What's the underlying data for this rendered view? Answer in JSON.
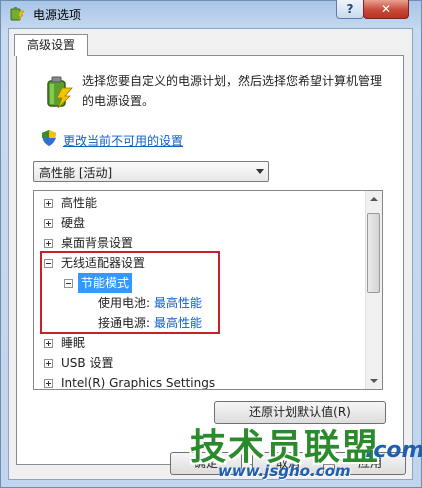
{
  "window": {
    "title": "电源选项",
    "help_label": "?",
    "close_label": "✕"
  },
  "tab": {
    "label": "高级设置"
  },
  "description": {
    "line1": "选择您要自定义的电源计划，然后选择您希望计算机管理",
    "line2": "的电源设置。"
  },
  "change_link": "更改当前不可用的设置",
  "plan_select": {
    "value": "高性能 [活动]"
  },
  "tree": {
    "items": [
      {
        "label": "高性能",
        "expander": "plus"
      },
      {
        "label": "硬盘",
        "expander": "plus"
      },
      {
        "label": "桌面背景设置",
        "expander": "plus"
      },
      {
        "label": "无线适配器设置",
        "expander": "minus"
      },
      {
        "label": "节能模式",
        "expander": "minus",
        "selected": true
      },
      {
        "label": "使用电池:",
        "value": "最高性能"
      },
      {
        "label": "接通电源:",
        "value": "最高性能"
      },
      {
        "label": "睡眠",
        "expander": "plus"
      },
      {
        "label": "USB 设置",
        "expander": "plus"
      },
      {
        "label": "Intel(R) Graphics Settings",
        "expander": "plus"
      }
    ]
  },
  "buttons": {
    "restore": "还原计划默认值(R)",
    "ok": "确定",
    "cancel": "取消",
    "apply": "应用"
  },
  "watermark": {
    "main": "技术员联盟",
    "url": "www.jsgho.com",
    "com": ".com"
  },
  "colors": {
    "highlight": "#3399ff",
    "link": "#0f5ec8",
    "annotation": "#c8202a"
  }
}
